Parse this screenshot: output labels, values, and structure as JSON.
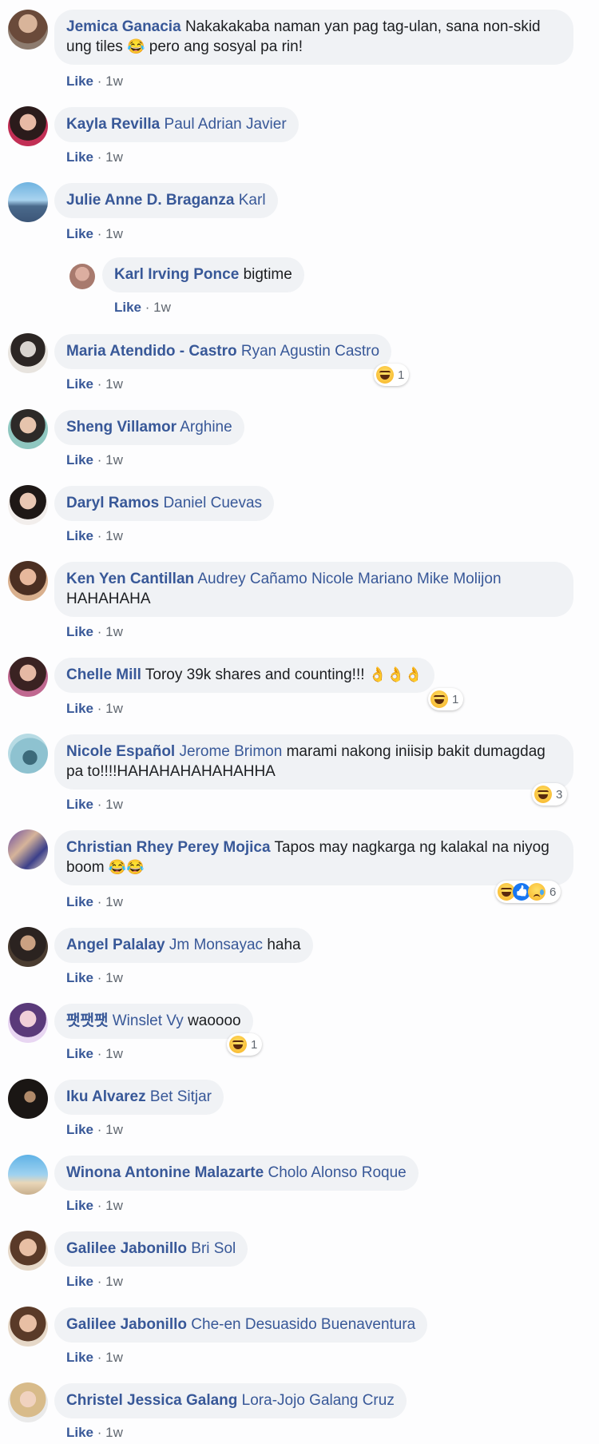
{
  "comments": [
    {
      "author": "Jemica Ganacia",
      "text_before": "Nakakakaba naman yan pag tag-ulan, sana non-skid ung tiles",
      "emoji": "😂",
      "text_after": "pero ang sosyal pa rin!",
      "like": "Like",
      "time": "1w"
    },
    {
      "author": "Kayla Revilla",
      "tag": "Paul Adrian Javier",
      "like": "Like",
      "time": "1w"
    },
    {
      "author": "Julie Anne D. Braganza",
      "tag": "Karl",
      "like": "Like",
      "time": "1w"
    },
    {
      "author": "Karl Irving Ponce",
      "text": "bigtime",
      "like": "Like",
      "time": "1w"
    },
    {
      "author": "Maria Atendido - Castro",
      "tag": "Ryan Agustin Castro",
      "like": "Like",
      "time": "1w",
      "reaction_count": "1"
    },
    {
      "author": "Sheng Villamor",
      "tag": "Arghine",
      "like": "Like",
      "time": "1w"
    },
    {
      "author": "Daryl Ramos",
      "tag": "Daniel Cuevas",
      "like": "Like",
      "time": "1w"
    },
    {
      "author": "Ken Yen Cantillan",
      "tag": "Audrey Cañamo Nicole Mariano Mike Molijon",
      "text": "HAHAHAHA",
      "like": "Like",
      "time": "1w"
    },
    {
      "author": "Chelle Mill",
      "text": "Toroy 39k shares and counting!!!",
      "emoji": "👌👌👌",
      "like": "Like",
      "time": "1w",
      "reaction_count": "1"
    },
    {
      "author": "Nicole Español",
      "tag": "Jerome Brimon",
      "text": "marami nakong iniisip bakit dumagdag pa to!!!!HAHAHAHAHAHAHHA",
      "like": "Like",
      "time": "1w",
      "reaction_count": "3"
    },
    {
      "author": "Christian Rhey Perey Mojica",
      "text": "Tapos may nagkarga ng kalakal na niyog boom",
      "emoji": "😂😂",
      "like": "Like",
      "time": "1w",
      "reaction_count": "6"
    },
    {
      "author": "Angel Palalay",
      "tag": "Jm Monsayac",
      "text": "haha",
      "like": "Like",
      "time": "1w"
    },
    {
      "author": "팻팻팻",
      "tag": "Winslet Vy",
      "text": "waoooo",
      "like": "Like",
      "time": "1w",
      "reaction_count": "1"
    },
    {
      "author": "Iku Alvarez",
      "tag": "Bet Sitjar",
      "like": "Like",
      "time": "1w"
    },
    {
      "author": "Winona Antonine Malazarte",
      "tag": "Cholo Alonso Roque",
      "like": "Like",
      "time": "1w"
    },
    {
      "author": "Galilee Jabonillo",
      "tag": "Bri Sol",
      "like": "Like",
      "time": "1w"
    },
    {
      "author": "Galilee Jabonillo",
      "tag": "Che-en Desuasido Buenaventura",
      "like": "Like",
      "time": "1w"
    },
    {
      "author": "Christel Jessica Galang",
      "tag": "Lora-Jojo Galang Cruz",
      "like": "Like",
      "time": "1w"
    }
  ],
  "separator": "·",
  "colors": {
    "link": "#385898",
    "bubble": "#f0f2f5",
    "meta": "#606770"
  }
}
